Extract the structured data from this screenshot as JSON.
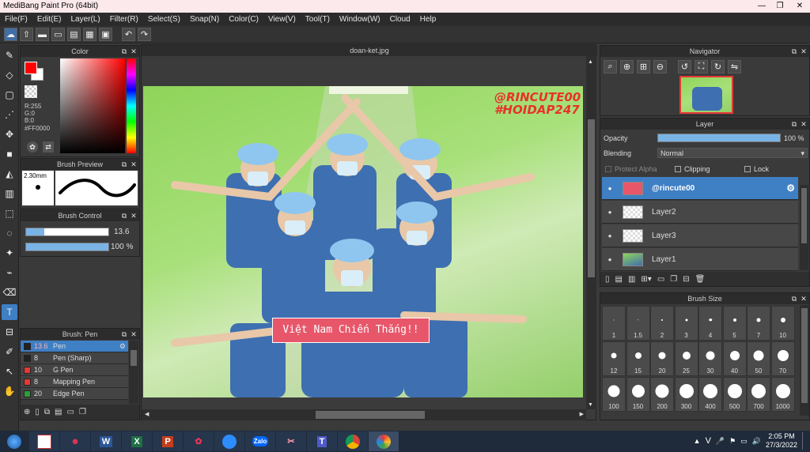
{
  "window": {
    "title": "MediBang Paint Pro (64bit)"
  },
  "menu": [
    "File(F)",
    "Edit(E)",
    "Layer(L)",
    "Filter(R)",
    "Select(S)",
    "Snap(N)",
    "Color(C)",
    "View(V)",
    "Tool(T)",
    "Window(W)",
    "Cloud",
    "Help"
  ],
  "color_panel": {
    "title": "Color",
    "r": "R:255",
    "g": "G:0",
    "b": "B:0",
    "hex": "#FF0000",
    "fg": "#ff0000"
  },
  "brush_preview": {
    "title": "Brush Preview",
    "size": "2.30mm"
  },
  "brush_control": {
    "title": "Brush Control",
    "size_value": "13.6",
    "opacity_value": "100 %",
    "size_fill": 0.22,
    "opacity_fill": 1.0
  },
  "brush_list": {
    "title": "Brush: Pen",
    "items": [
      {
        "size": "13.6",
        "name": "Pen",
        "color": "#222222"
      },
      {
        "size": "8",
        "name": "Pen (Sharp)",
        "color": "#222222"
      },
      {
        "size": "10",
        "name": "G Pen",
        "color": "#e53935"
      },
      {
        "size": "8",
        "name": "Mapping Pen",
        "color": "#e53935"
      },
      {
        "size": "20",
        "name": "Edge Pen",
        "color": "#2e9e3a"
      }
    ]
  },
  "document": {
    "tab": "doan-ket.jpg",
    "watermark1": "@RINCUTE00",
    "watermark2": "#HOIDAP247",
    "caption": "Việt Nam Chiến Thắng!!"
  },
  "navigator": {
    "title": "Navigator"
  },
  "layer_panel": {
    "title": "Layer",
    "opacity_label": "Opacity",
    "opacity_value": "100 %",
    "opacity_fill": 1.0,
    "blending_label": "Blending",
    "blending_value": "Normal",
    "protect_alpha": "Protect Alpha",
    "clipping": "Clipping",
    "lock": "Lock",
    "layers": [
      {
        "name": "@rincute00",
        "selected": true
      },
      {
        "name": "Layer2",
        "selected": false
      },
      {
        "name": "Layer3",
        "selected": false
      },
      {
        "name": "Layer1",
        "selected": false
      }
    ]
  },
  "brush_size": {
    "title": "Brush Size",
    "sizes": [
      "1",
      "1.5",
      "2",
      "3",
      "4",
      "5",
      "7",
      "10",
      "12",
      "15",
      "20",
      "25",
      "30",
      "40",
      "50",
      "70",
      "100",
      "150",
      "200",
      "300",
      "400",
      "500",
      "700",
      "1000"
    ]
  },
  "taskbar": {
    "time": "2:05 PM",
    "date": "27/3/2022",
    "zalo": "Zalo",
    "lang": "V"
  }
}
